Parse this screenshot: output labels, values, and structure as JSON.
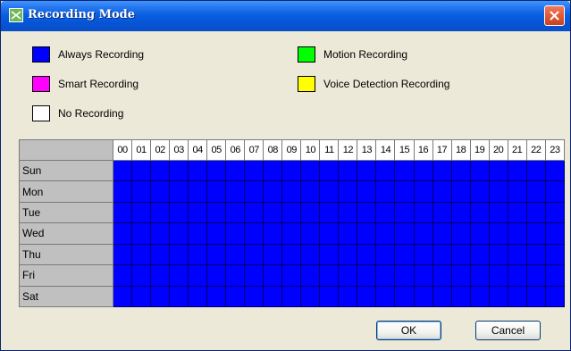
{
  "window": {
    "title": "Recording Mode"
  },
  "legend": [
    {
      "label": "Always Recording",
      "color": "#0000ff"
    },
    {
      "label": "Motion Recording",
      "color": "#00ff00"
    },
    {
      "label": "Smart Recording",
      "color": "#ff00ff"
    },
    {
      "label": "Voice Detection Recording",
      "color": "#ffff00"
    },
    {
      "label": "No Recording",
      "color": "#ffffff"
    }
  ],
  "schedule": {
    "hours": [
      "00",
      "01",
      "02",
      "03",
      "04",
      "05",
      "06",
      "07",
      "08",
      "09",
      "10",
      "11",
      "12",
      "13",
      "14",
      "15",
      "16",
      "17",
      "18",
      "19",
      "20",
      "21",
      "22",
      "23"
    ],
    "days": [
      "Sun",
      "Mon",
      "Tue",
      "Wed",
      "Thu",
      "Fri",
      "Sat"
    ],
    "cell_mode": "Always Recording",
    "cell_color": "#0000ff"
  },
  "buttons": {
    "ok": "OK",
    "cancel": "Cancel"
  },
  "colors": {
    "titlebar": "#0a5fe0",
    "dialog_background": "#ece9d8",
    "grid_header": "#c0c0c0"
  }
}
